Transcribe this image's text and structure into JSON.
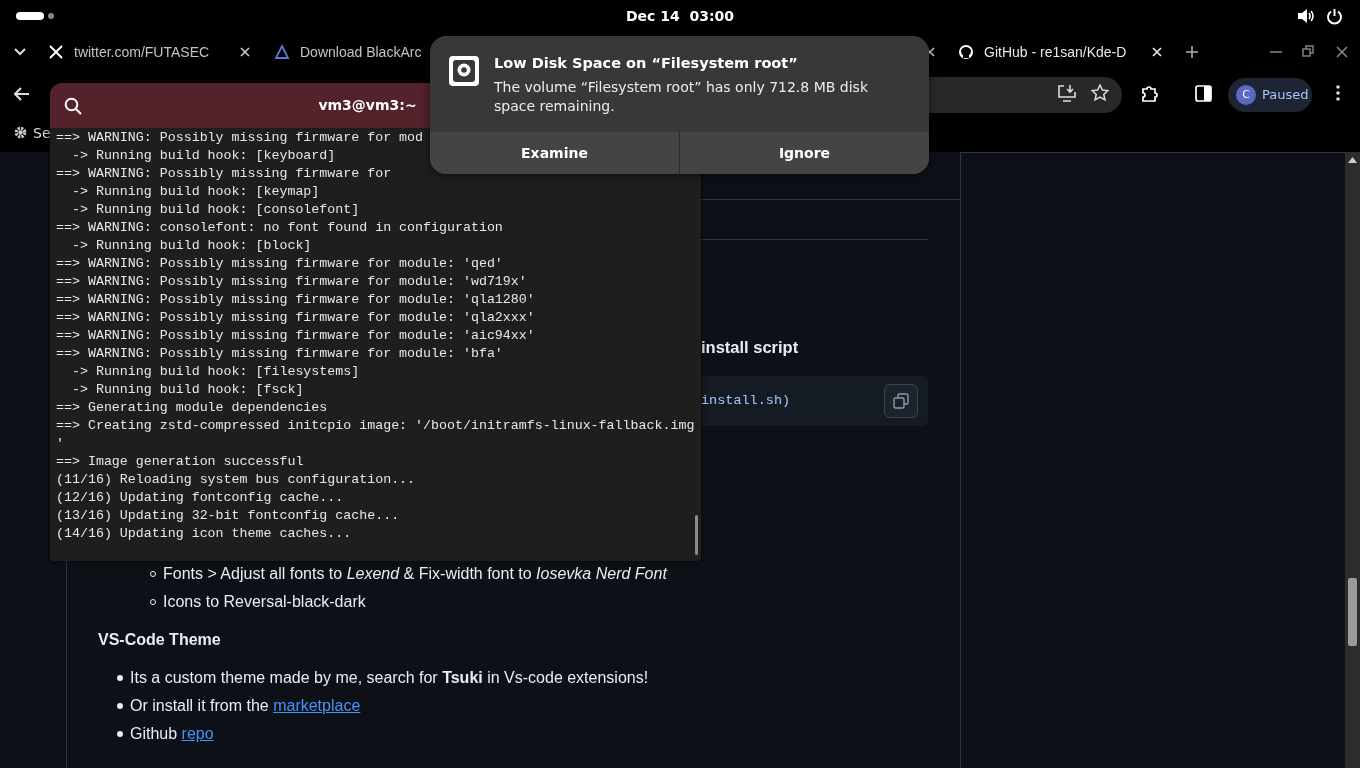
{
  "top_bar": {
    "date": "Dec 14",
    "time": "03:00"
  },
  "browser": {
    "tabs": [
      {
        "title": "twitter.com/FUTASEC",
        "selected": false,
        "closable": true
      },
      {
        "title": "Download BlackArc",
        "selected": false,
        "closable": false
      },
      {
        "title": "GitHub - re1san/Kde-D",
        "selected": true,
        "closable": true
      }
    ],
    "bookmark_fragment": "Se",
    "profile": {
      "initial": "C",
      "status": "Paused"
    }
  },
  "page": {
    "heading_fragment": "install script",
    "code_fragment": "install.sh)",
    "sub_items": [
      "Fonts > Adjust all fonts to *Lexend* & Fix-width font to *Iosevka Nerd Font*",
      "Icons to Reversal-black-dark"
    ],
    "section_heading": "VS-Code Theme",
    "items": [
      {
        "text": "Its a custom theme made by me, search for **Tsuki** in Vs-code extensions!"
      },
      {
        "text": "Or install it from the ",
        "link": "marketplace"
      },
      {
        "text": "Github ",
        "link": "repo"
      }
    ]
  },
  "terminal": {
    "title": "vm3@vm3:~",
    "lines": [
      "==> WARNING: Possibly missing firmware for mod",
      "  -> Running build hook: [keyboard]",
      "==> WARNING: Possibly missing firmware for",
      "  -> Running build hook: [keymap]",
      "  -> Running build hook: [consolefont]",
      "==> WARNING: consolefont: no font found in configuration",
      "  -> Running build hook: [block]",
      "==> WARNING: Possibly missing firmware for module: 'qed'",
      "==> WARNING: Possibly missing firmware for module: 'wd719x'",
      "==> WARNING: Possibly missing firmware for module: 'qla1280'",
      "==> WARNING: Possibly missing firmware for module: 'qla2xxx'",
      "==> WARNING: Possibly missing firmware for module: 'aic94xx'",
      "==> WARNING: Possibly missing firmware for module: 'bfa'",
      "  -> Running build hook: [filesystems]",
      "  -> Running build hook: [fsck]",
      "==> Generating module dependencies",
      "==> Creating zstd-compressed initcpio image: '/boot/initramfs-linux-fallback.img",
      "'",
      "==> Image generation successful",
      "(11/16) Reloading system bus configuration...",
      "(12/16) Updating fontconfig cache...",
      "(13/16) Updating 32-bit fontconfig cache...",
      "(14/16) Updating icon theme caches..."
    ]
  },
  "notification": {
    "title": "Low Disk Space on “Filesystem root”",
    "body": "The volume “Filesystem root” has only 712.8 MB disk space remaining.",
    "actions": [
      "Examine",
      "Ignore"
    ]
  }
}
